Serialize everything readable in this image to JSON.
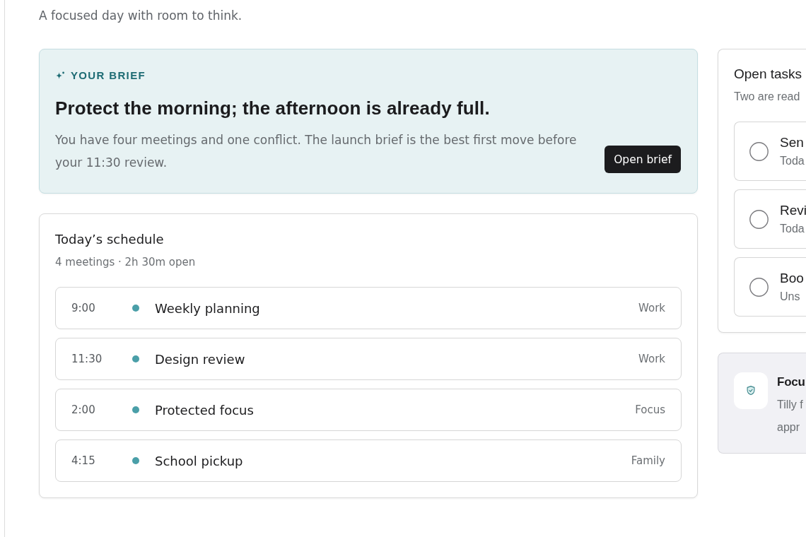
{
  "header": {
    "subtitle": "A focused day with room to think."
  },
  "brief": {
    "label": "YOUR BRIEF",
    "title": "Protect the morning; the afternoon is already full.",
    "body": "You have four meetings and one conflict. The launch brief is the best first move before your 11:30 review.",
    "button": "Open brief"
  },
  "schedule": {
    "title": "Today’s schedule",
    "summary": "4 meetings · 2h 30m open",
    "events": [
      {
        "time": "9:00",
        "title": "Weekly planning",
        "category": "Work"
      },
      {
        "time": "11:30",
        "title": "Design review",
        "category": "Work"
      },
      {
        "time": "2:00",
        "title": "Protected focus",
        "category": "Focus"
      },
      {
        "time": "4:15",
        "title": "School pickup",
        "category": "Family"
      }
    ]
  },
  "tasks": {
    "title": "Open tasks",
    "subtitle": "Two are read",
    "items": [
      {
        "title": "Sen",
        "due": "Toda",
        "checked": false
      },
      {
        "title": "Revi",
        "due": "Toda",
        "checked": false
      },
      {
        "title": "Boo",
        "due": "Uns",
        "checked": false
      }
    ]
  },
  "focus_card": {
    "title": "Focu",
    "lines": [
      "Tilly f",
      "appr"
    ]
  }
}
